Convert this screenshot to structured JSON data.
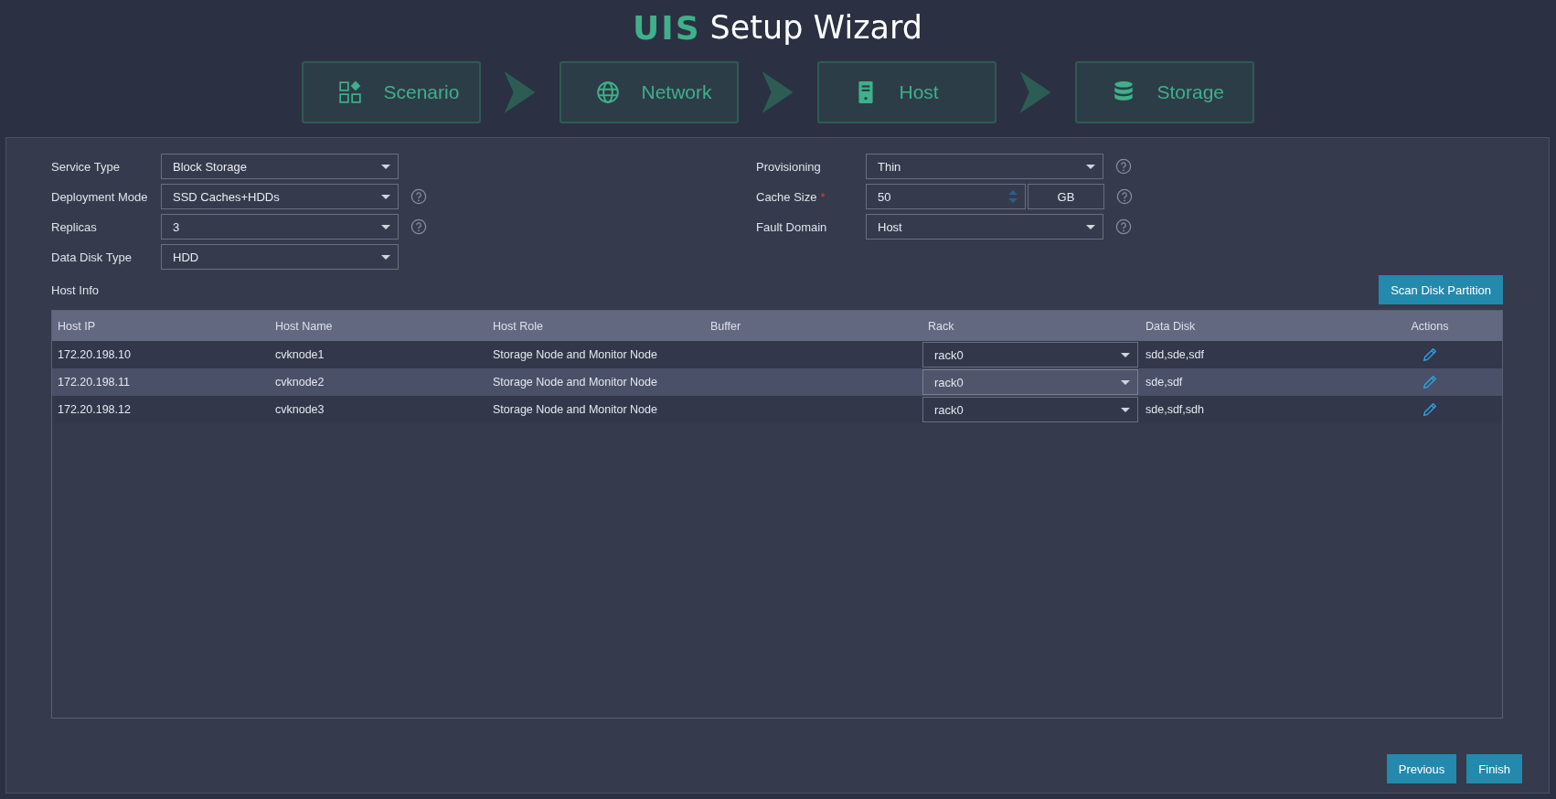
{
  "header": {
    "logo": "UIS",
    "title": "Setup Wizard"
  },
  "steps": [
    {
      "label": "Scenario"
    },
    {
      "label": "Network"
    },
    {
      "label": "Host"
    },
    {
      "label": "Storage"
    }
  ],
  "form_left": [
    {
      "label": "Service Type",
      "kind": "select",
      "value": "Block Storage",
      "help": false
    },
    {
      "label": "Deployment Mode",
      "kind": "select",
      "value": "SSD Caches+HDDs",
      "help": true
    },
    {
      "label": "Replicas",
      "kind": "select",
      "value": "3",
      "help": true
    },
    {
      "label": "Data Disk Type",
      "kind": "select",
      "value": "HDD",
      "help": false
    }
  ],
  "form_right": [
    {
      "label": "Provisioning",
      "kind": "select",
      "value": "Thin",
      "help": true
    },
    {
      "label": "Cache Size",
      "required_mark": "*",
      "kind": "number",
      "value": "50",
      "unit": "GB",
      "help": true
    },
    {
      "label": "Fault Domain",
      "kind": "select",
      "value": "Host",
      "help": true
    }
  ],
  "host_info": {
    "label": "Host Info",
    "scan_button": "Scan Disk Partition"
  },
  "table": {
    "columns": [
      "Host IP",
      "Host Name",
      "Host Role",
      "Buffer",
      "Rack",
      "Data Disk",
      "Actions"
    ],
    "rows": [
      {
        "ip": "172.20.198.10",
        "name": "cvknode1",
        "role": "Storage Node and Monitor Node",
        "rack": "rack0",
        "disks": "sdd,sde,sdf",
        "selected": false
      },
      {
        "ip": "172.20.198.11",
        "name": "cvknode2",
        "role": "Storage Node and Monitor Node",
        "rack": "rack0",
        "disks": "sde,sdf",
        "selected": true
      },
      {
        "ip": "172.20.198.12",
        "name": "cvknode3",
        "role": "Storage Node and Monitor Node",
        "rack": "rack0",
        "disks": "sde,sdf,sdh",
        "selected": false
      }
    ]
  },
  "buttons": [
    "Previous",
    "Finish"
  ]
}
